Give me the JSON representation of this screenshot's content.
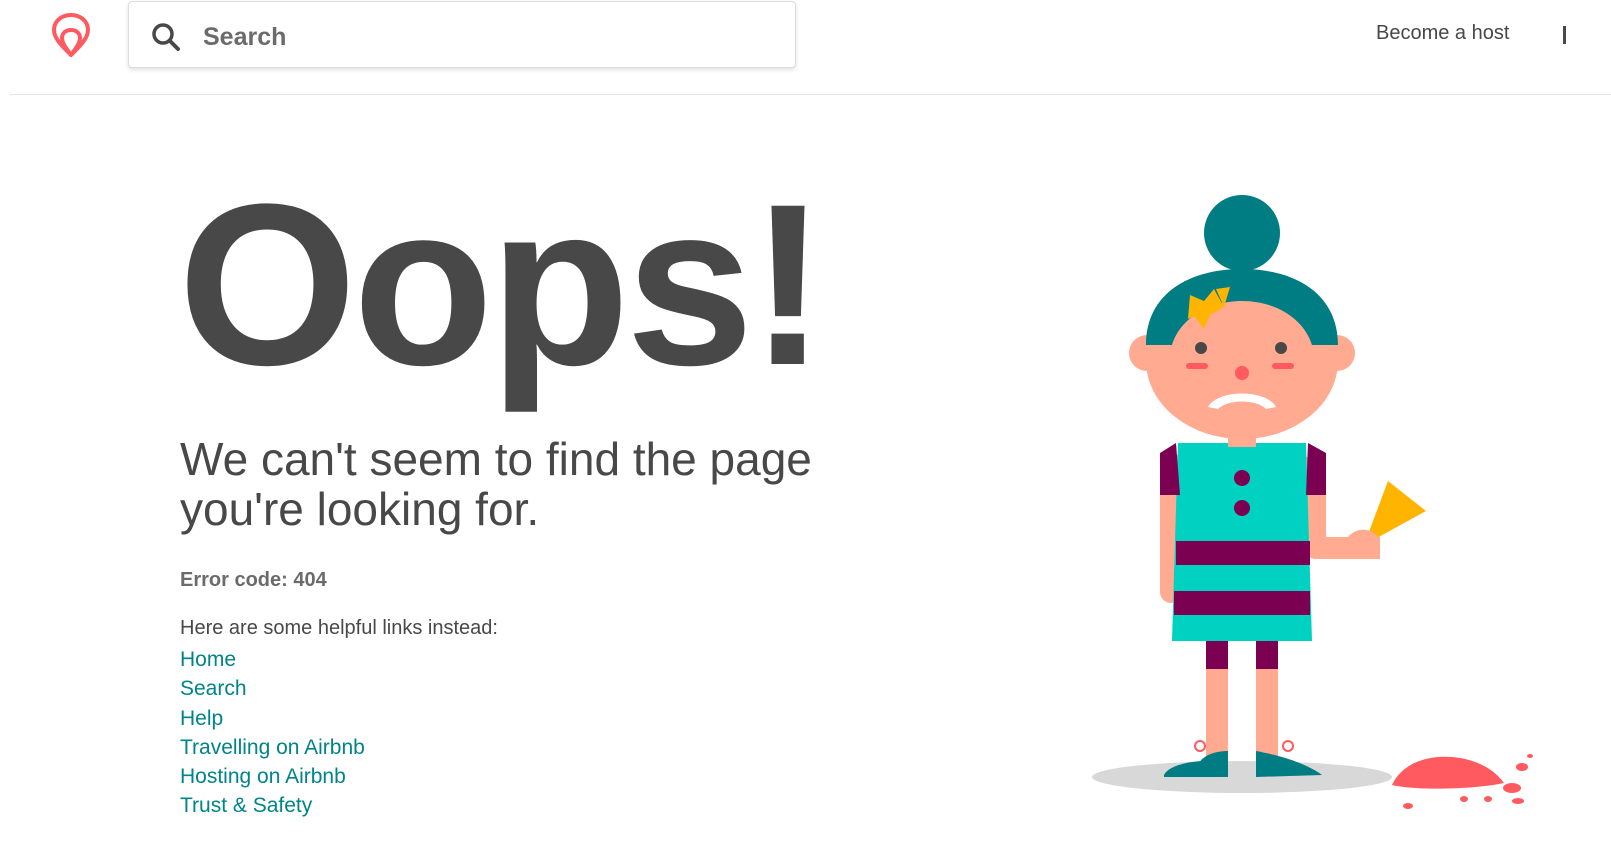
{
  "header": {
    "logo_icon": "airbnb-belo-icon",
    "search_icon": "search-icon",
    "search_placeholder": "Search",
    "become_host_label": "Become a host"
  },
  "main": {
    "title": "Oops!",
    "subtitle_line1": "We can't seem to find the page",
    "subtitle_line2": "you're looking for.",
    "error_code": "Error code: 404",
    "helpful_text": "Here are some helpful links instead:",
    "links": [
      {
        "label": "Home"
      },
      {
        "label": "Search"
      },
      {
        "label": "Help"
      },
      {
        "label": "Travelling on Airbnb"
      },
      {
        "label": "Hosting on Airbnb"
      },
      {
        "label": "Trust & Safety"
      }
    ]
  },
  "colors": {
    "brand": "#FF5A5F",
    "link": "#008489",
    "text": "#484848",
    "hair": "#007C83",
    "dress": "#00D1C1",
    "stripe": "#7B0051",
    "skin": "#FFAA91",
    "ice_cream_cone": "#FFB400"
  }
}
